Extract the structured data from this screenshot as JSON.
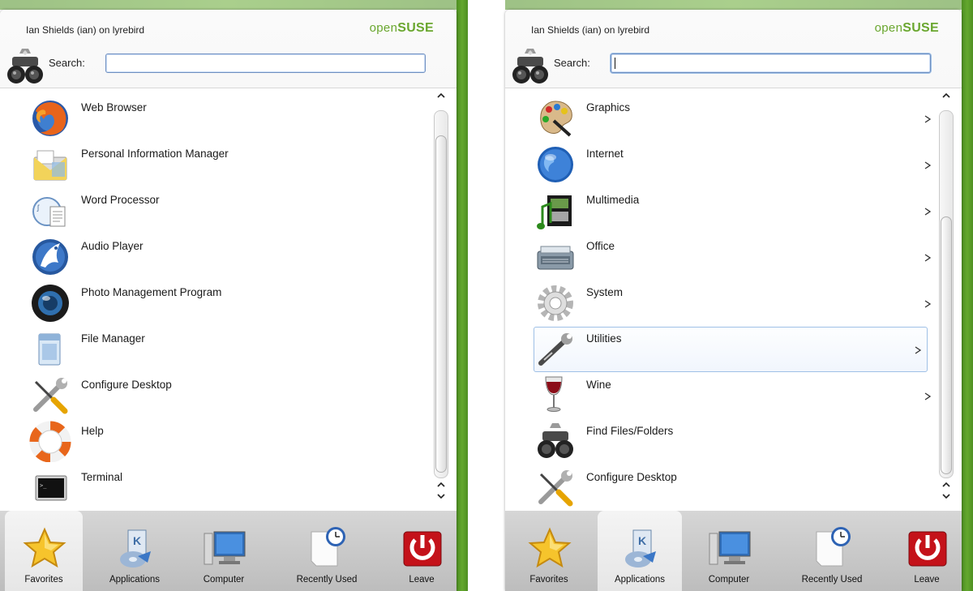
{
  "panels": [
    {
      "header": {
        "user_text": "Ian Shields (ian) on lyrebird",
        "brand_light": "open",
        "brand_bold": "SUSE"
      },
      "search": {
        "label": "Search:",
        "value": ""
      },
      "items": [
        {
          "label": "Web Browser",
          "icon": "firefox-icon"
        },
        {
          "label": "Personal Information Manager",
          "icon": "pim-icon"
        },
        {
          "label": "Word Processor",
          "icon": "word-processor-icon"
        },
        {
          "label": "Audio Player",
          "icon": "audio-player-icon"
        },
        {
          "label": "Photo Management Program",
          "icon": "photo-icon"
        },
        {
          "label": "File Manager",
          "icon": "file-manager-icon"
        },
        {
          "label": "Configure Desktop",
          "icon": "configure-icon"
        },
        {
          "label": "Help",
          "icon": "help-lifebuoy-icon"
        },
        {
          "label": "Terminal",
          "icon": "terminal-icon"
        }
      ],
      "tabs": [
        {
          "label": "Favorites",
          "icon": "star-icon"
        },
        {
          "label": "Applications",
          "icon": "applications-icon"
        },
        {
          "label": "Computer",
          "icon": "computer-icon"
        },
        {
          "label": "Recently Used",
          "icon": "recently-used-icon"
        },
        {
          "label": "Leave",
          "icon": "leave-icon"
        }
      ],
      "active_tab": "Favorites"
    },
    {
      "header": {
        "user_text": "Ian Shields (ian) on lyrebird",
        "brand_light": "open",
        "brand_bold": "SUSE"
      },
      "search": {
        "label": "Search:",
        "value": ""
      },
      "items": [
        {
          "label": "Graphics",
          "icon": "graphics-palette-icon",
          "submenu": true
        },
        {
          "label": "Internet",
          "icon": "internet-globe-icon",
          "submenu": true
        },
        {
          "label": "Multimedia",
          "icon": "multimedia-icon",
          "submenu": true
        },
        {
          "label": "Office",
          "icon": "office-icon",
          "submenu": true
        },
        {
          "label": "System",
          "icon": "system-gear-icon",
          "submenu": true
        },
        {
          "label": "Utilities",
          "icon": "utilities-icon",
          "submenu": true,
          "highlighted": true
        },
        {
          "label": "Wine",
          "icon": "wine-glass-icon",
          "submenu": true
        },
        {
          "label": "Find Files/Folders",
          "icon": "find-files-icon"
        },
        {
          "label": "Configure Desktop",
          "icon": "configure-icon"
        }
      ],
      "tabs": [
        {
          "label": "Favorites",
          "icon": "star-icon"
        },
        {
          "label": "Applications",
          "icon": "applications-icon"
        },
        {
          "label": "Computer",
          "icon": "computer-icon"
        },
        {
          "label": "Recently Used",
          "icon": "recently-used-icon"
        },
        {
          "label": "Leave",
          "icon": "leave-icon"
        }
      ],
      "active_tab": "Applications"
    }
  ],
  "colors": {
    "brand_green": "#6aa72f",
    "desktop_green": "#5a9e2a",
    "focus_blue": "#6f8fc0"
  }
}
